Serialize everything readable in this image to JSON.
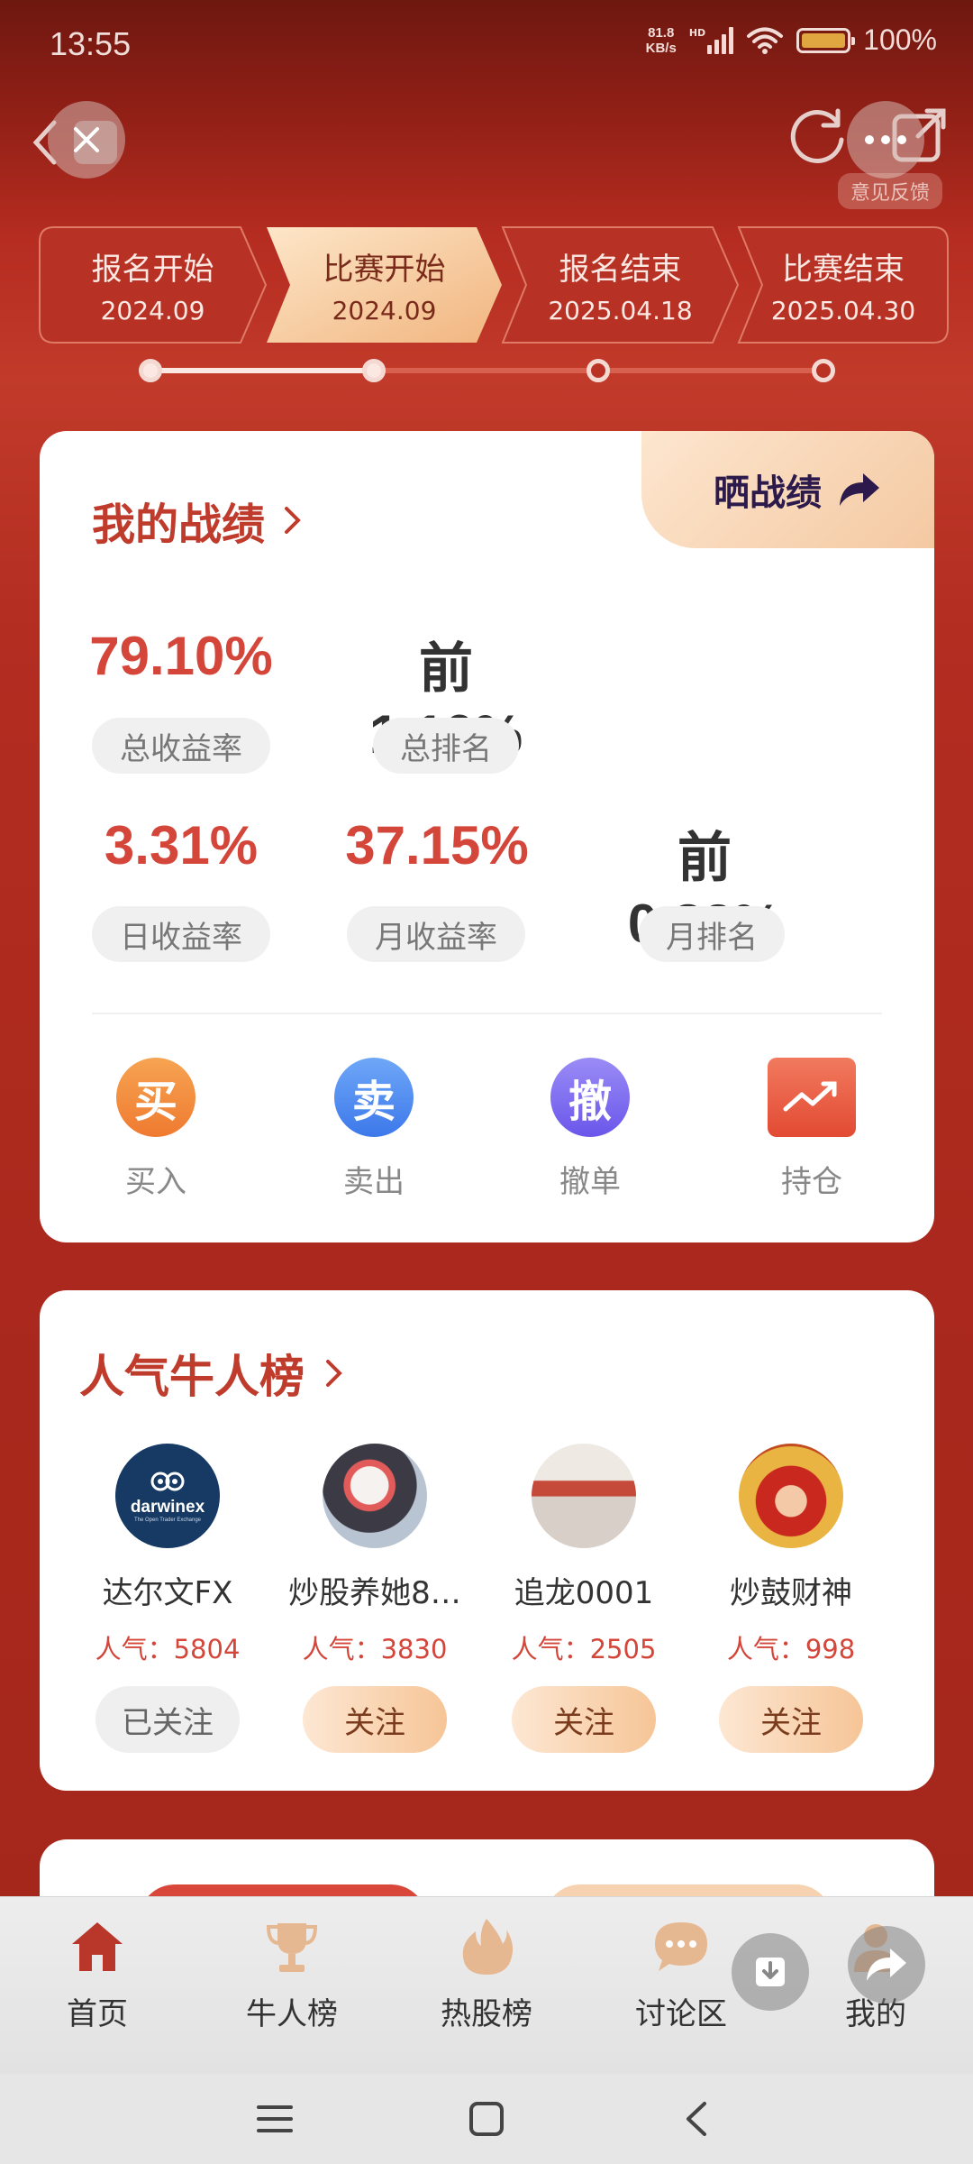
{
  "status_bar": {
    "time": "13:55",
    "net_speed_value": "81.8",
    "net_speed_unit": "KB/s",
    "hd": "HD",
    "battery": "100%"
  },
  "top_nav": {
    "feedback": "意见反馈"
  },
  "stages": [
    {
      "title": "报名开始",
      "date": "2024.09"
    },
    {
      "title": "比赛开始",
      "date": "2024.09"
    },
    {
      "title": "报名结束",
      "date": "2025.04.18"
    },
    {
      "title": "比赛结束",
      "date": "2025.04.30"
    }
  ],
  "my_record": {
    "title": "我的战绩",
    "share_label": "晒战绩",
    "stats": [
      {
        "value": "79.10%",
        "label": "总收益率"
      },
      {
        "value": "前1.10%",
        "label": "总排名"
      },
      {
        "value": "3.31%",
        "label": "日收益率"
      },
      {
        "value": "37.15%",
        "label": "月收益率"
      },
      {
        "value": "前0.82%",
        "label": "月排名"
      }
    ],
    "actions": [
      {
        "icon_char": "买",
        "label": "买入",
        "color": "#f08a3c"
      },
      {
        "icon_char": "卖",
        "label": "卖出",
        "color": "#4a8cf0"
      },
      {
        "icon_char": "撤",
        "label": "撤单",
        "color": "#7c6bf0"
      },
      {
        "icon": "chart-trend-icon",
        "label": "持仓",
        "color": "#e8553e"
      }
    ]
  },
  "popular_ranking": {
    "title": "人气牛人榜",
    "traders": [
      {
        "name": "达尔文FX",
        "popularity": "人气：5804",
        "button": "已关注",
        "avatar_text": "darwinex",
        "avatar_sub": "The Open Trader Exchange"
      },
      {
        "name": "炒股养她8…",
        "popularity": "人气：3830",
        "button": "关注"
      },
      {
        "name": "追龙0001",
        "popularity": "人气：2505",
        "button": "关注"
      },
      {
        "name": "炒鼓财神",
        "popularity": "人气：998",
        "button": "关注"
      }
    ]
  },
  "bottom_nav": {
    "items": [
      {
        "label": "首页",
        "icon": "home-icon",
        "active": true
      },
      {
        "label": "牛人榜",
        "icon": "trophy-icon"
      },
      {
        "label": "热股榜",
        "icon": "flame-icon"
      },
      {
        "label": "讨论区",
        "icon": "chat-bubble-icon"
      },
      {
        "label": "我的",
        "icon": "user-icon"
      }
    ]
  },
  "colors": {
    "accent_red": "#d4453a",
    "title_red": "#bf3b2c",
    "bg_red": "#aa281d",
    "gold": "#f6c597"
  }
}
